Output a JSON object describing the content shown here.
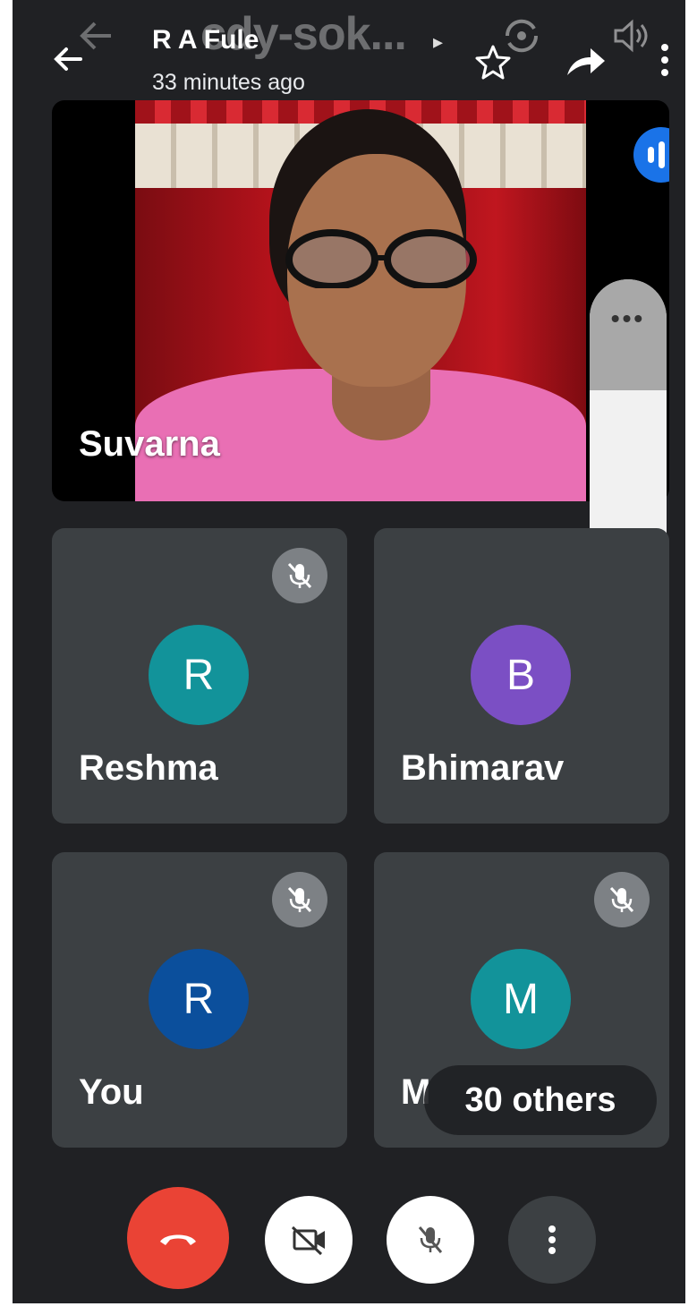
{
  "header": {
    "ghost_title": "cdy-sok...",
    "title": "R A Fule",
    "subtitle": "33 minutes ago"
  },
  "main_tile": {
    "name": "Suvarna"
  },
  "participants": [
    {
      "name": "Reshma",
      "initial": "R",
      "color": "#12939A",
      "muted": true
    },
    {
      "name": "Bhimarav",
      "initial": "B",
      "color": "#7B4FC4",
      "muted": false
    },
    {
      "name": "You",
      "initial": "R",
      "color": "#0B4F9C",
      "muted": true
    },
    {
      "name": "M",
      "initial": "M",
      "color": "#12939A",
      "muted": true
    }
  ],
  "others_pill": "30 others",
  "side_panel": {
    "dots": "•••"
  },
  "colors": {
    "end_call": "#EA4335",
    "tile_bg": "#3c4043",
    "screen_bg": "#202124"
  },
  "icons": [
    "back-arrow-icon",
    "star-icon",
    "share-icon",
    "rotate-camera-icon",
    "speaker-icon",
    "more-vert-icon",
    "speaking-icon",
    "mic-off-icon",
    "phone-icon",
    "end-call-icon",
    "camera-off-icon"
  ]
}
